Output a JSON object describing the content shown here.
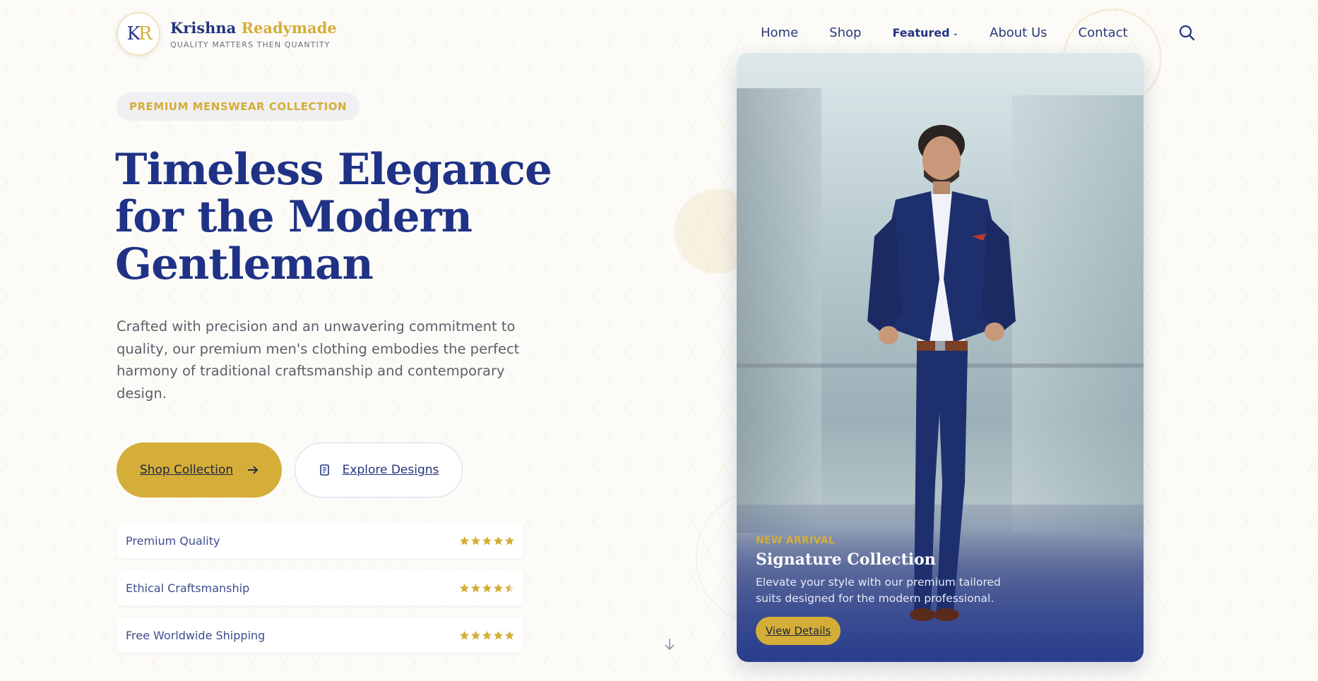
{
  "brand": {
    "logo_mark_k": "K",
    "logo_mark_r": "R",
    "name_part1": "Krishna",
    "name_part2": "Readymade",
    "tagline": "QUALITY MATTERS THEN QUANTITY"
  },
  "nav": {
    "items": [
      "Home",
      "Shop",
      "Featured",
      "About Us",
      "Contact"
    ],
    "featured_chevron": "⌄"
  },
  "hero": {
    "badge": "PREMIUM MENSWEAR COLLECTION",
    "headline_line1": "Timeless Elegance",
    "headline_line2": "for the Modern",
    "headline_line3": "Gentleman",
    "description": "Crafted with precision and an unwavering commitment to quality, our premium men's clothing embodies the perfect harmony of traditional craftsmanship and contemporary design.",
    "primary_button": "Shop Collection",
    "secondary_button": "Explore Designs"
  },
  "features": [
    {
      "label": "Premium Quality",
      "rating": 5
    },
    {
      "label": "Ethical Craftsmanship",
      "rating": 4.5
    },
    {
      "label": "Free Worldwide Shipping",
      "rating": 5
    }
  ],
  "card": {
    "eyebrow": "NEW ARRIVAL",
    "title": "Signature Collection",
    "description": "Elevate your style with our premium tailored suits designed for the modern professional.",
    "button": "View Details"
  },
  "icons": {
    "search": "search-icon",
    "arrow_right": "arrow-right-icon",
    "scroll": "scroll-icon",
    "star": "star-icon",
    "chevron_down": "chevron-down-icon",
    "scroll_down": "arrow-down-icon"
  },
  "colors": {
    "navy": "#1f3285",
    "gold": "#d4ae38",
    "text_gray": "#5c5f6a",
    "background": "#fcfbf8"
  }
}
